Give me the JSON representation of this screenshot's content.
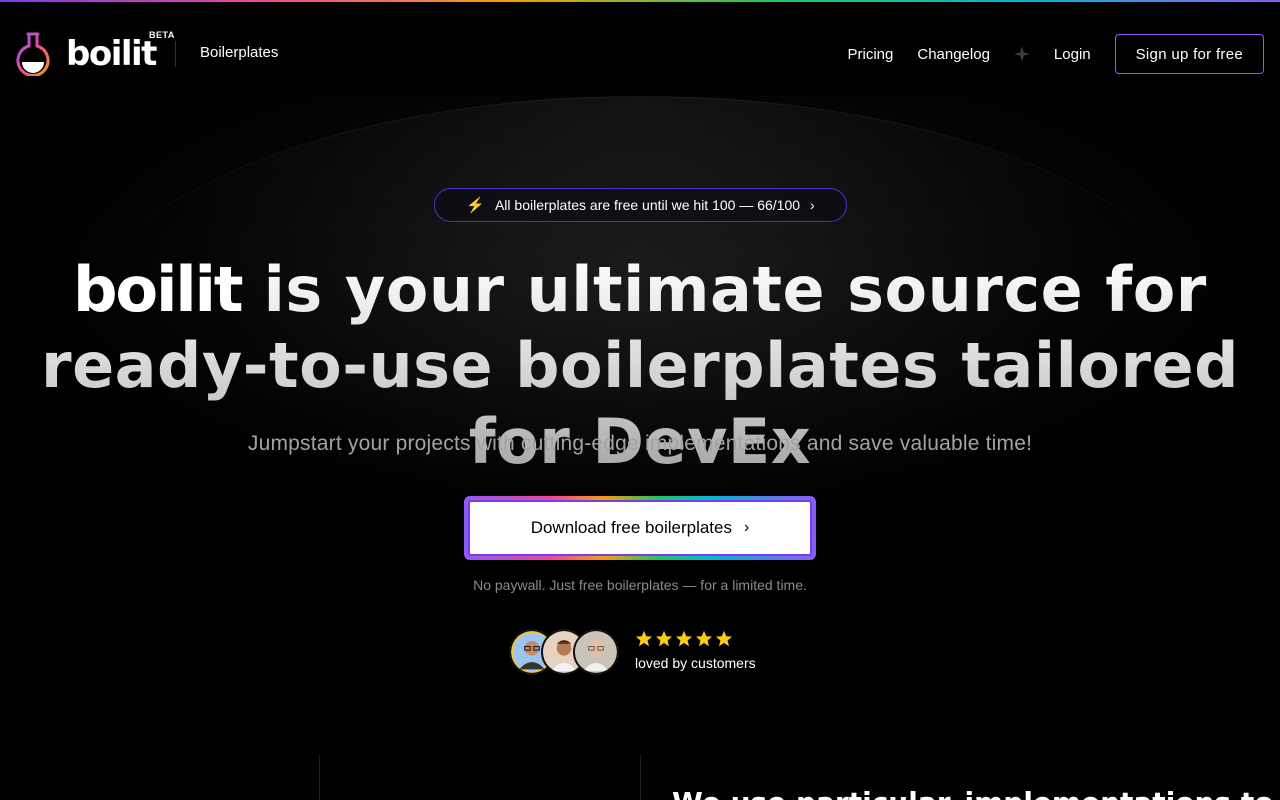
{
  "colors": {
    "accent": "#8b5cf6",
    "bolt": "#facc15",
    "star": "#facc15",
    "background": "#000000"
  },
  "header": {
    "logo_text": "boilit",
    "beta_label": "BETA",
    "nav_left": "Boilerplates",
    "nav_right": [
      "Pricing",
      "Changelog"
    ],
    "login_label": "Login",
    "signup_label": "Sign up for free"
  },
  "announcement": {
    "icon": "bolt-icon",
    "text": "All boilerplates are free until we hit 100 — 66/100",
    "chevron": "chevron-right-icon"
  },
  "hero": {
    "brand": "boilit",
    "headline_rest": " is your ultimate source for ready-to-use boilerplates tailored for DevEx",
    "subtitle": "Jumpstart your projects with cutting-edge implementations and save valuable time!",
    "cta_label": "Download free boilerplates",
    "note": "No paywall. Just free boilerplates — for a limited time."
  },
  "social_proof": {
    "avatars": [
      "avatar-1",
      "avatar-2",
      "avatar-3"
    ],
    "rating": 5,
    "label": "loved by customers"
  },
  "bottom": {
    "heading": "We use particular_implementations to show basic"
  }
}
